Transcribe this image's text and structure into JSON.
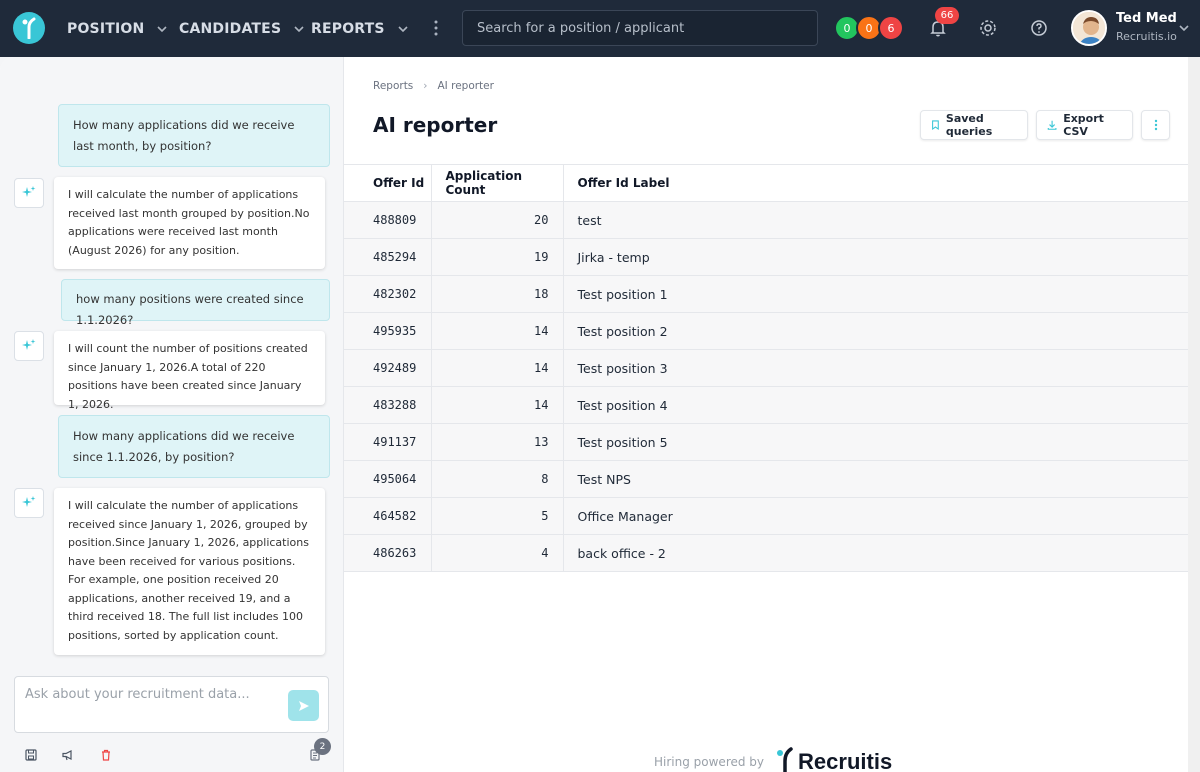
{
  "nav": {
    "items": [
      {
        "label": "POSITION"
      },
      {
        "label": "CANDIDATES"
      },
      {
        "label": "REPORTS"
      }
    ],
    "search_placeholder": "Search for a position / applicant",
    "status_dots": [
      {
        "value": "0",
        "color": "#22c55e"
      },
      {
        "value": "0",
        "color": "#f97316"
      },
      {
        "value": "6",
        "color": "#ef4444"
      }
    ],
    "notifications_count": "66",
    "user": {
      "name": "Ted Med",
      "org": "Recruitis.io"
    }
  },
  "chat": {
    "messages": [
      {
        "role": "user",
        "text": "How many applications did we receive last month, by position?"
      },
      {
        "role": "ai",
        "text": "I will calculate the number of applications received last month grouped by position.No applications were received last month (August 2026) for any position."
      },
      {
        "role": "user",
        "text": "how many positions were created since 1.1.2026?"
      },
      {
        "role": "ai",
        "text": "I will count the number of positions created since January 1, 2026.A total of 220 positions have been created since January 1, 2026."
      },
      {
        "role": "user",
        "text": "How many applications did we receive since 1.1.2026, by position?"
      },
      {
        "role": "ai",
        "text": "I will calculate the number of applications received since January 1, 2026, grouped by position.Since January 1, 2026, applications have been received for various positions. For example, one position received 20 applications, another received 19, and a third received 18. The full list includes 100 positions, sorted by application count."
      }
    ],
    "input_placeholder": "Ask about your recruitment data...",
    "history_count": "2"
  },
  "breadcrumb": {
    "items": [
      "Reports",
      "AI reporter"
    ]
  },
  "page": {
    "title": "AI reporter",
    "saved_queries_label": "Saved queries",
    "export_label": "Export CSV"
  },
  "table": {
    "headers": [
      "Offer Id",
      "Application Count",
      "Offer Id Label"
    ],
    "rows": [
      [
        "488809",
        "20",
        "test"
      ],
      [
        "485294",
        "19",
        "Jirka - temp"
      ],
      [
        "482302",
        "18",
        "Test position 1"
      ],
      [
        "495935",
        "14",
        "Test position 2"
      ],
      [
        "492489",
        "14",
        "Test position 3"
      ],
      [
        "483288",
        "14",
        "Test position 4"
      ],
      [
        "491137",
        "13",
        "Test position 5"
      ],
      [
        "495064",
        "8",
        "Test NPS"
      ],
      [
        "464582",
        "5",
        "Office Manager"
      ],
      [
        "486263",
        "4",
        "back office - 2"
      ]
    ]
  },
  "footer": {
    "powered_by": "Hiring powered by",
    "brand": "Recruitis"
  },
  "colors": {
    "accent": "#39c6d6",
    "nav_bg": "#1f2a3a",
    "danger": "#ef4444"
  }
}
